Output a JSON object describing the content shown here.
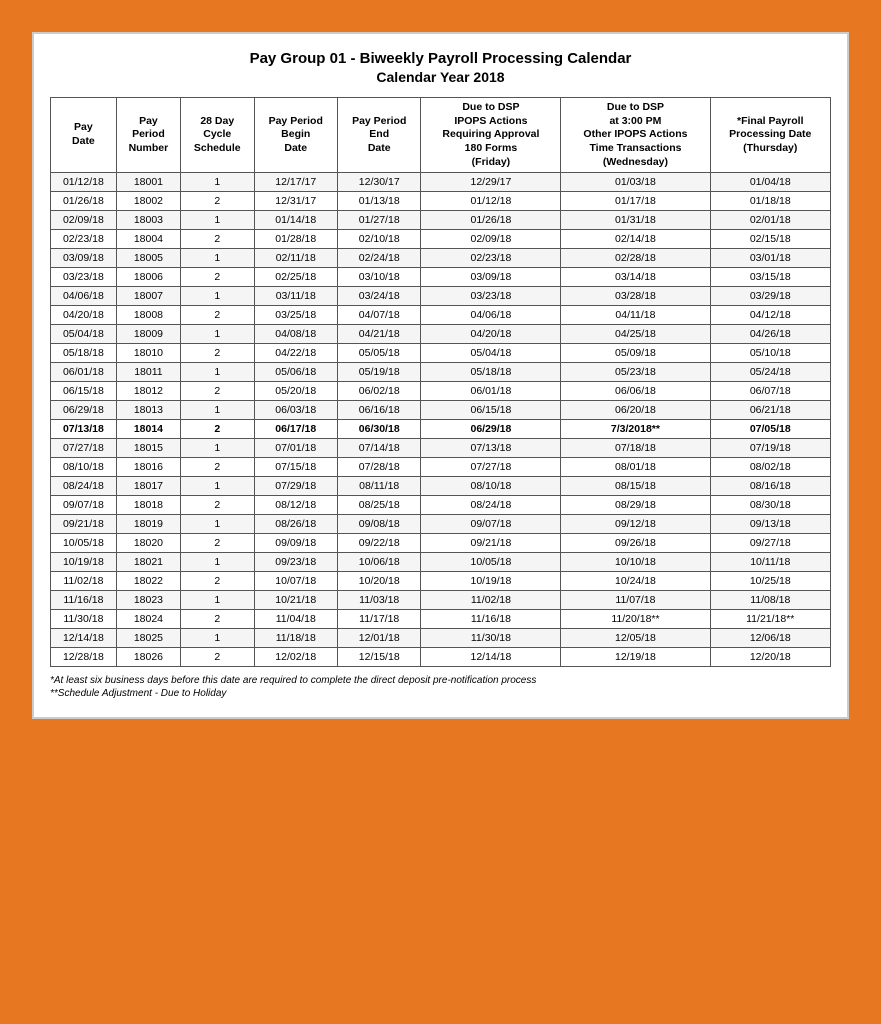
{
  "title": "Pay Group 01 - Biweekly Payroll Processing Calendar",
  "subtitle": "Calendar Year 2018",
  "headers": {
    "payDate": "Pay Date",
    "payPeriodNumber": "Pay Period Number",
    "cycleSchedule": "28 Day Cycle Schedule",
    "beginDate": "Pay Period Begin Date",
    "endDate": "Pay Period End Date",
    "dueDSP_Friday": "Due to DSP\nIPOPS Actions Requiring Approval\n180 Forms\n(Friday)",
    "dueDSP_Wednesday": "Due to DSP at 3:00 PM\nOther IPOPS Actions\nTime Transactions\n(Wednesday)",
    "finalProcessing": "*Final Payroll Processing Date\n(Thursday)"
  },
  "rows": [
    {
      "payDate": "01/12/18",
      "ppNum": "18001",
      "cycle": "1",
      "begin": "12/17/17",
      "end": "12/30/17",
      "friday": "12/29/17",
      "wednesday": "01/03/18",
      "thursday": "01/04/18",
      "bold": false
    },
    {
      "payDate": "01/26/18",
      "ppNum": "18002",
      "cycle": "2",
      "begin": "12/31/17",
      "end": "01/13/18",
      "friday": "01/12/18",
      "wednesday": "01/17/18",
      "thursday": "01/18/18",
      "bold": false
    },
    {
      "payDate": "02/09/18",
      "ppNum": "18003",
      "cycle": "1",
      "begin": "01/14/18",
      "end": "01/27/18",
      "friday": "01/26/18",
      "wednesday": "01/31/18",
      "thursday": "02/01/18",
      "bold": false
    },
    {
      "payDate": "02/23/18",
      "ppNum": "18004",
      "cycle": "2",
      "begin": "01/28/18",
      "end": "02/10/18",
      "friday": "02/09/18",
      "wednesday": "02/14/18",
      "thursday": "02/15/18",
      "bold": false
    },
    {
      "payDate": "03/09/18",
      "ppNum": "18005",
      "cycle": "1",
      "begin": "02/11/18",
      "end": "02/24/18",
      "friday": "02/23/18",
      "wednesday": "02/28/18",
      "thursday": "03/01/18",
      "bold": false
    },
    {
      "payDate": "03/23/18",
      "ppNum": "18006",
      "cycle": "2",
      "begin": "02/25/18",
      "end": "03/10/18",
      "friday": "03/09/18",
      "wednesday": "03/14/18",
      "thursday": "03/15/18",
      "bold": false
    },
    {
      "payDate": "04/06/18",
      "ppNum": "18007",
      "cycle": "1",
      "begin": "03/11/18",
      "end": "03/24/18",
      "friday": "03/23/18",
      "wednesday": "03/28/18",
      "thursday": "03/29/18",
      "bold": false
    },
    {
      "payDate": "04/20/18",
      "ppNum": "18008",
      "cycle": "2",
      "begin": "03/25/18",
      "end": "04/07/18",
      "friday": "04/06/18",
      "wednesday": "04/11/18",
      "thursday": "04/12/18",
      "bold": false
    },
    {
      "payDate": "05/04/18",
      "ppNum": "18009",
      "cycle": "1",
      "begin": "04/08/18",
      "end": "04/21/18",
      "friday": "04/20/18",
      "wednesday": "04/25/18",
      "thursday": "04/26/18",
      "bold": false
    },
    {
      "payDate": "05/18/18",
      "ppNum": "18010",
      "cycle": "2",
      "begin": "04/22/18",
      "end": "05/05/18",
      "friday": "05/04/18",
      "wednesday": "05/09/18",
      "thursday": "05/10/18",
      "bold": false
    },
    {
      "payDate": "06/01/18",
      "ppNum": "18011",
      "cycle": "1",
      "begin": "05/06/18",
      "end": "05/19/18",
      "friday": "05/18/18",
      "wednesday": "05/23/18",
      "thursday": "05/24/18",
      "bold": false
    },
    {
      "payDate": "06/15/18",
      "ppNum": "18012",
      "cycle": "2",
      "begin": "05/20/18",
      "end": "06/02/18",
      "friday": "06/01/18",
      "wednesday": "06/06/18",
      "thursday": "06/07/18",
      "bold": false
    },
    {
      "payDate": "06/29/18",
      "ppNum": "18013",
      "cycle": "1",
      "begin": "06/03/18",
      "end": "06/16/18",
      "friday": "06/15/18",
      "wednesday": "06/20/18",
      "thursday": "06/21/18",
      "bold": false
    },
    {
      "payDate": "07/13/18",
      "ppNum": "18014",
      "cycle": "2",
      "begin": "06/17/18",
      "end": "06/30/18",
      "friday": "06/29/18",
      "wednesday": "7/3/2018**",
      "thursday": "07/05/18",
      "bold": true
    },
    {
      "payDate": "07/27/18",
      "ppNum": "18015",
      "cycle": "1",
      "begin": "07/01/18",
      "end": "07/14/18",
      "friday": "07/13/18",
      "wednesday": "07/18/18",
      "thursday": "07/19/18",
      "bold": false
    },
    {
      "payDate": "08/10/18",
      "ppNum": "18016",
      "cycle": "2",
      "begin": "07/15/18",
      "end": "07/28/18",
      "friday": "07/27/18",
      "wednesday": "08/01/18",
      "thursday": "08/02/18",
      "bold": false
    },
    {
      "payDate": "08/24/18",
      "ppNum": "18017",
      "cycle": "1",
      "begin": "07/29/18",
      "end": "08/11/18",
      "friday": "08/10/18",
      "wednesday": "08/15/18",
      "thursday": "08/16/18",
      "bold": false
    },
    {
      "payDate": "09/07/18",
      "ppNum": "18018",
      "cycle": "2",
      "begin": "08/12/18",
      "end": "08/25/18",
      "friday": "08/24/18",
      "wednesday": "08/29/18",
      "thursday": "08/30/18",
      "bold": false
    },
    {
      "payDate": "09/21/18",
      "ppNum": "18019",
      "cycle": "1",
      "begin": "08/26/18",
      "end": "09/08/18",
      "friday": "09/07/18",
      "wednesday": "09/12/18",
      "thursday": "09/13/18",
      "bold": false
    },
    {
      "payDate": "10/05/18",
      "ppNum": "18020",
      "cycle": "2",
      "begin": "09/09/18",
      "end": "09/22/18",
      "friday": "09/21/18",
      "wednesday": "09/26/18",
      "thursday": "09/27/18",
      "bold": false
    },
    {
      "payDate": "10/19/18",
      "ppNum": "18021",
      "cycle": "1",
      "begin": "09/23/18",
      "end": "10/06/18",
      "friday": "10/05/18",
      "wednesday": "10/10/18",
      "thursday": "10/11/18",
      "bold": false
    },
    {
      "payDate": "11/02/18",
      "ppNum": "18022",
      "cycle": "2",
      "begin": "10/07/18",
      "end": "10/20/18",
      "friday": "10/19/18",
      "wednesday": "10/24/18",
      "thursday": "10/25/18",
      "bold": false
    },
    {
      "payDate": "11/16/18",
      "ppNum": "18023",
      "cycle": "1",
      "begin": "10/21/18",
      "end": "11/03/18",
      "friday": "11/02/18",
      "wednesday": "11/07/18",
      "thursday": "11/08/18",
      "bold": false
    },
    {
      "payDate": "11/30/18",
      "ppNum": "18024",
      "cycle": "2",
      "begin": "11/04/18",
      "end": "11/17/18",
      "friday": "11/16/18",
      "wednesday": "11/20/18**",
      "thursday": "11/21/18**",
      "bold": false
    },
    {
      "payDate": "12/14/18",
      "ppNum": "18025",
      "cycle": "1",
      "begin": "11/18/18",
      "end": "12/01/18",
      "friday": "11/30/18",
      "wednesday": "12/05/18",
      "thursday": "12/06/18",
      "bold": false
    },
    {
      "payDate": "12/28/18",
      "ppNum": "18026",
      "cycle": "2",
      "begin": "12/02/18",
      "end": "12/15/18",
      "friday": "12/14/18",
      "wednesday": "12/19/18",
      "thursday": "12/20/18",
      "bold": false
    }
  ],
  "footnotes": [
    "*At least six business days before this date are required to complete the direct deposit pre-notification process",
    "**Schedule Adjustment - Due to Holiday"
  ]
}
